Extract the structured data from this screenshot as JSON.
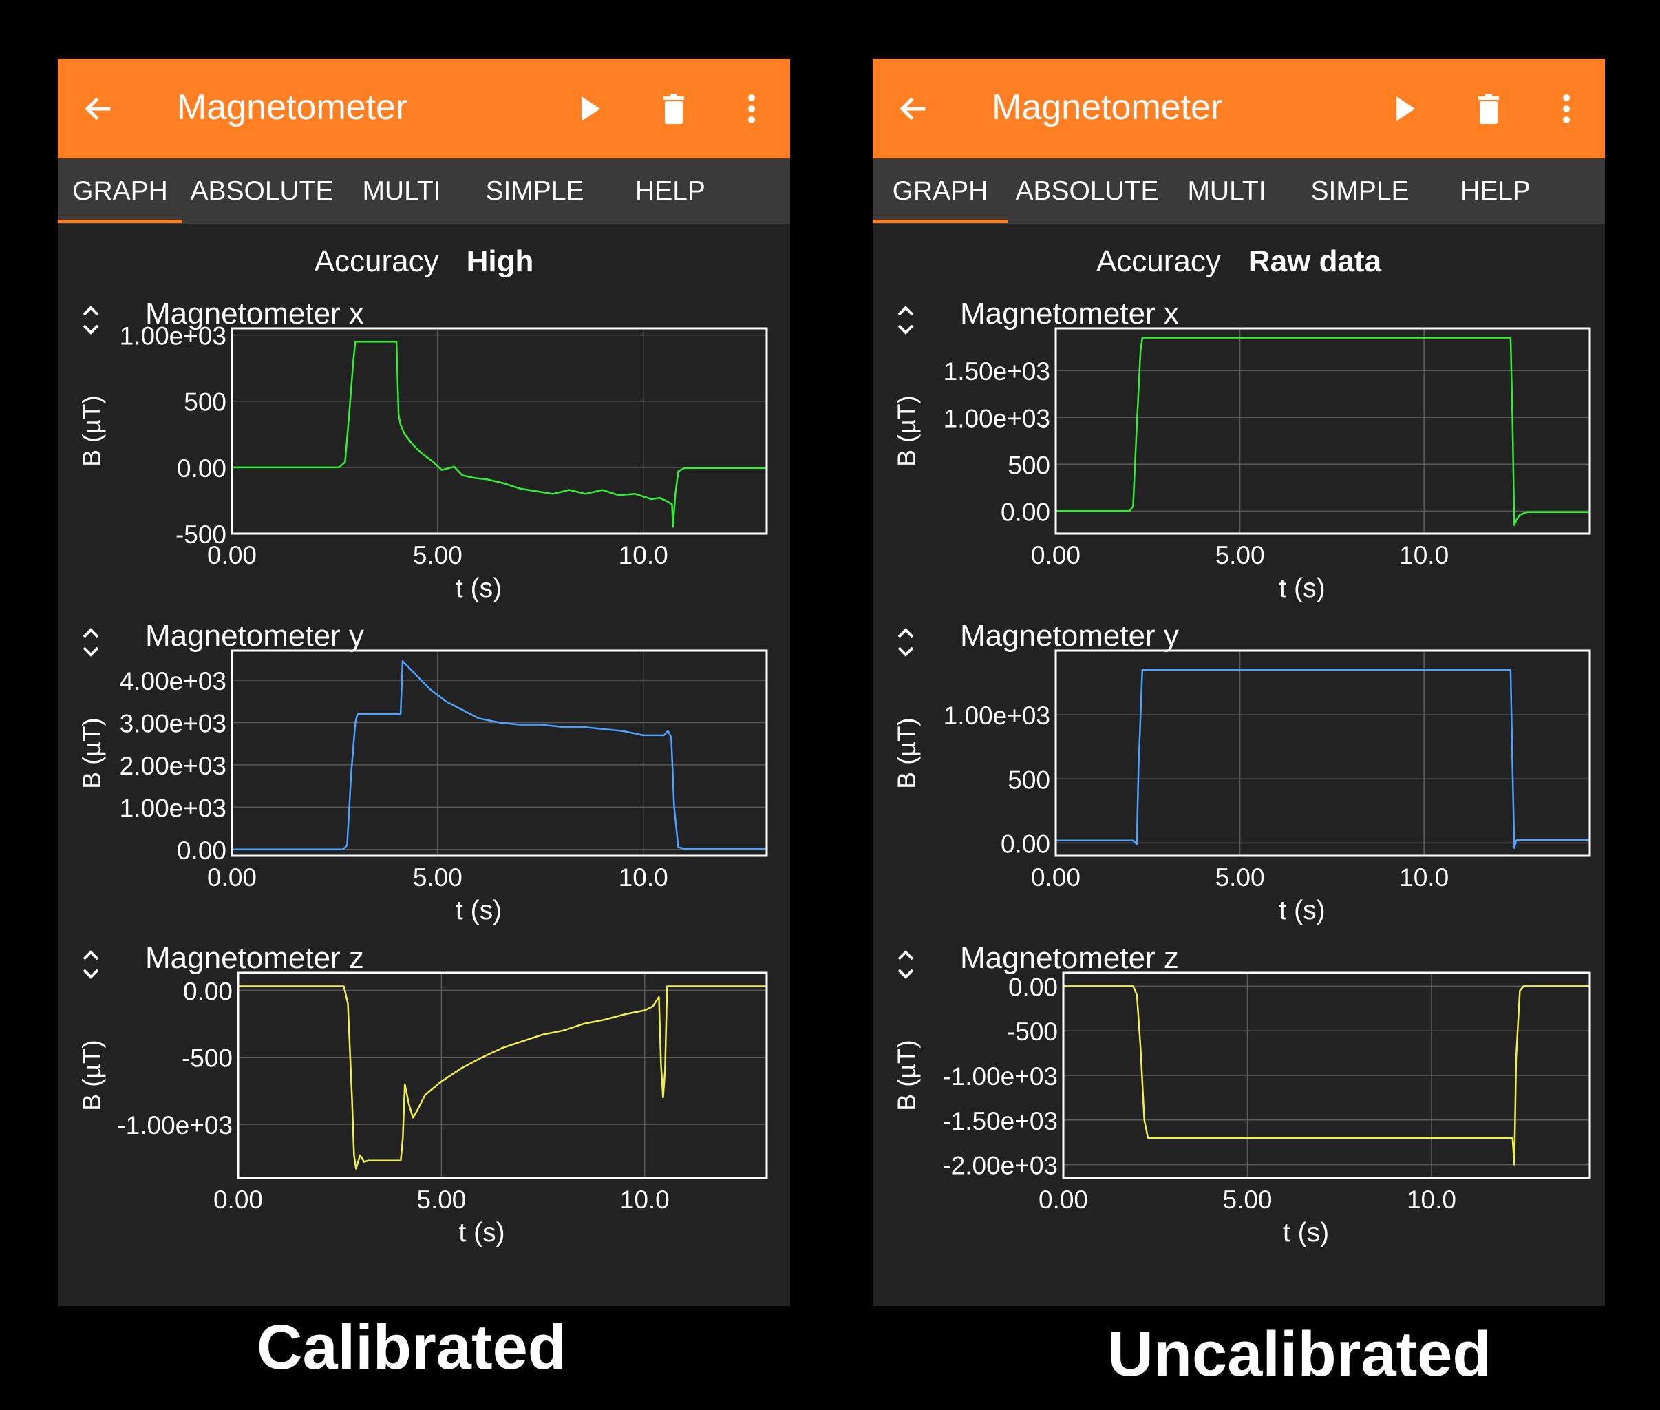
{
  "screens": [
    {
      "app_title": "Magnetometer",
      "tabs": [
        "GRAPH",
        "ABSOLUTE",
        "MULTI",
        "SIMPLE",
        "HELP"
      ],
      "active_tab": "GRAPH",
      "accuracy_label": "Accuracy",
      "accuracy_value": "High",
      "caption": "Calibrated",
      "colors": {
        "appbar": "#ff7f22",
        "background": "#222222",
        "tabbar": "#3a3a3a"
      },
      "icons": [
        "back-arrow-icon",
        "play-icon",
        "trash-icon",
        "more-vert-icon"
      ]
    },
    {
      "app_title": "Magnetometer",
      "tabs": [
        "GRAPH",
        "ABSOLUTE",
        "MULTI",
        "SIMPLE",
        "HELP"
      ],
      "active_tab": "GRAPH",
      "accuracy_label": "Accuracy",
      "accuracy_value": "Raw data",
      "caption": "Uncalibrated",
      "colors": {
        "appbar": "#ff7f22",
        "background": "#222222",
        "tabbar": "#3a3a3a"
      },
      "icons": [
        "back-arrow-icon",
        "play-icon",
        "trash-icon",
        "more-vert-icon"
      ]
    }
  ],
  "chart_data": [
    {
      "screen": "Calibrated",
      "type": "line",
      "title": "Magnetometer x",
      "xlabel": "t (s)",
      "ylabel": "B (µT)",
      "color": "#33ee33",
      "xlim": [
        0,
        13
      ],
      "ylim": [
        -500,
        1050
      ],
      "xticks": [
        0,
        5,
        10
      ],
      "xtick_labels": [
        "0.00",
        "5.00",
        "10.0"
      ],
      "yticks": [
        1000,
        500,
        0,
        -500
      ],
      "ytick_labels": [
        "1.00e+03",
        "500",
        "0.00",
        "-500"
      ],
      "x": [
        0,
        2.6,
        2.75,
        2.85,
        2.95,
        3.0,
        4.0,
        4.05,
        4.1,
        4.2,
        4.4,
        4.6,
        4.9,
        5.1,
        5.4,
        5.6,
        5.9,
        6.2,
        6.6,
        7.0,
        7.4,
        7.8,
        8.2,
        8.6,
        9.0,
        9.4,
        9.8,
        10.2,
        10.4,
        10.6,
        10.7,
        10.72,
        10.78,
        10.85,
        11.0,
        13.0
      ],
      "y": [
        0,
        0,
        40,
        400,
        800,
        950,
        950,
        400,
        320,
        250,
        170,
        110,
        40,
        -20,
        5,
        -60,
        -80,
        -90,
        -120,
        -160,
        -180,
        -200,
        -170,
        -200,
        -170,
        -210,
        -200,
        -240,
        -230,
        -260,
        -280,
        -450,
        -200,
        -30,
        -5,
        -5
      ]
    },
    {
      "screen": "Calibrated",
      "type": "line",
      "title": "Magnetometer y",
      "xlabel": "t (s)",
      "ylabel": "B (µT)",
      "color": "#4da3ff",
      "xlim": [
        0,
        13
      ],
      "ylim": [
        -150,
        4700
      ],
      "xticks": [
        0,
        5,
        10
      ],
      "xtick_labels": [
        "0.00",
        "5.00",
        "10.0"
      ],
      "yticks": [
        4000,
        3000,
        2000,
        1000,
        0
      ],
      "ytick_labels": [
        "4.00e+03",
        "3.00e+03",
        "2.00e+03",
        "1.00e+03",
        "0.00"
      ],
      "x": [
        0,
        2.7,
        2.8,
        2.9,
        3.0,
        3.05,
        4.1,
        4.15,
        4.2,
        4.5,
        4.8,
        5.2,
        5.6,
        6.0,
        6.5,
        7.0,
        7.5,
        8.0,
        8.5,
        9.0,
        9.5,
        10.0,
        10.5,
        10.6,
        10.68,
        10.75,
        10.85,
        11.0,
        13.0
      ],
      "y": [
        0,
        0,
        100,
        1800,
        3000,
        3200,
        3200,
        4450,
        4400,
        4100,
        3800,
        3500,
        3300,
        3100,
        3000,
        2950,
        2950,
        2900,
        2900,
        2850,
        2800,
        2700,
        2700,
        2800,
        2650,
        1000,
        50,
        20,
        20
      ]
    },
    {
      "screen": "Calibrated",
      "type": "line",
      "title": "Magnetometer z",
      "xlabel": "t (s)",
      "ylabel": "B (µT)",
      "color": "#f0f04c",
      "xlim": [
        0,
        13
      ],
      "ylim": [
        -1400,
        130
      ],
      "xticks": [
        0,
        5,
        10
      ],
      "xtick_labels": [
        "0.00",
        "5.00",
        "10.0"
      ],
      "yticks": [
        0,
        -500,
        -1000
      ],
      "ytick_labels": [
        "0.00",
        "-500",
        "-1.00e+03"
      ],
      "x": [
        0,
        2.6,
        2.7,
        2.8,
        2.85,
        2.9,
        3.0,
        3.1,
        3.2,
        4.0,
        4.05,
        4.1,
        4.2,
        4.3,
        4.4,
        4.6,
        5.0,
        5.5,
        6.0,
        6.5,
        7.0,
        7.5,
        8.0,
        8.5,
        9.0,
        9.5,
        10.0,
        10.2,
        10.35,
        10.4,
        10.45,
        10.5,
        10.55,
        10.7,
        13.0
      ],
      "y": [
        30,
        30,
        -100,
        -800,
        -1230,
        -1330,
        -1230,
        -1280,
        -1270,
        -1270,
        -1100,
        -700,
        -850,
        -950,
        -900,
        -780,
        -680,
        -580,
        -500,
        -430,
        -380,
        -330,
        -300,
        -250,
        -220,
        -180,
        -150,
        -120,
        -50,
        -550,
        -800,
        -600,
        30,
        30,
        30
      ]
    },
    {
      "screen": "Uncalibrated",
      "type": "line",
      "title": "Magnetometer x",
      "xlabel": "t (s)",
      "ylabel": "B (µT)",
      "color": "#33ee33",
      "xlim": [
        0,
        14.5
      ],
      "ylim": [
        -240,
        1950
      ],
      "xticks": [
        0,
        5,
        10
      ],
      "xtick_labels": [
        "0.00",
        "5.00",
        "10.0"
      ],
      "yticks": [
        1500,
        1000,
        500,
        0
      ],
      "ytick_labels": [
        "1.50e+03",
        "1.00e+03",
        "500",
        "0.00"
      ],
      "x": [
        0,
        2.0,
        2.1,
        2.2,
        2.3,
        2.35,
        2.4,
        12.35,
        12.4,
        12.45,
        12.5,
        12.6,
        12.8,
        14.5
      ],
      "y": [
        0,
        0,
        50,
        900,
        1700,
        1850,
        1850,
        1850,
        1000,
        -150,
        -100,
        -40,
        -10,
        -10
      ]
    },
    {
      "screen": "Uncalibrated",
      "type": "line",
      "title": "Magnetometer y",
      "xlabel": "t (s)",
      "ylabel": "B (µT)",
      "color": "#4da3ff",
      "xlim": [
        0,
        14.5
      ],
      "ylim": [
        -100,
        1500
      ],
      "xticks": [
        0,
        5,
        10
      ],
      "xtick_labels": [
        "0.00",
        "5.00",
        "10.0"
      ],
      "yticks": [
        1000,
        500,
        0
      ],
      "ytick_labels": [
        "1.00e+03",
        "500",
        "0.00"
      ],
      "x": [
        0,
        2.1,
        2.2,
        2.25,
        2.35,
        2.4,
        12.35,
        12.4,
        12.45,
        12.5,
        12.6,
        14.5
      ],
      "y": [
        20,
        20,
        -10,
        600,
        1350,
        1350,
        1350,
        600,
        -40,
        20,
        25,
        25
      ]
    },
    {
      "screen": "Uncalibrated",
      "type": "line",
      "title": "Magnetometer z",
      "xlabel": "t (s)",
      "ylabel": "B (µT)",
      "color": "#f0f04c",
      "xlim": [
        0,
        14.3
      ],
      "ylim": [
        -2150,
        150
      ],
      "xticks": [
        0,
        5,
        10
      ],
      "xtick_labels": [
        "0.00",
        "5.00",
        "10.0"
      ],
      "yticks": [
        0,
        -500,
        -1000,
        -1500,
        -2000
      ],
      "ytick_labels": [
        "0.00",
        "-500",
        "-1.00e+03",
        "-1.50e+03",
        "-2.00e+03"
      ],
      "x": [
        0,
        1.9,
        2.0,
        2.1,
        2.2,
        2.3,
        12.2,
        12.25,
        12.3,
        12.4,
        12.5,
        14.3
      ],
      "y": [
        0,
        0,
        -100,
        -700,
        -1500,
        -1700,
        -1700,
        -2000,
        -800,
        -50,
        0,
        0
      ]
    }
  ]
}
